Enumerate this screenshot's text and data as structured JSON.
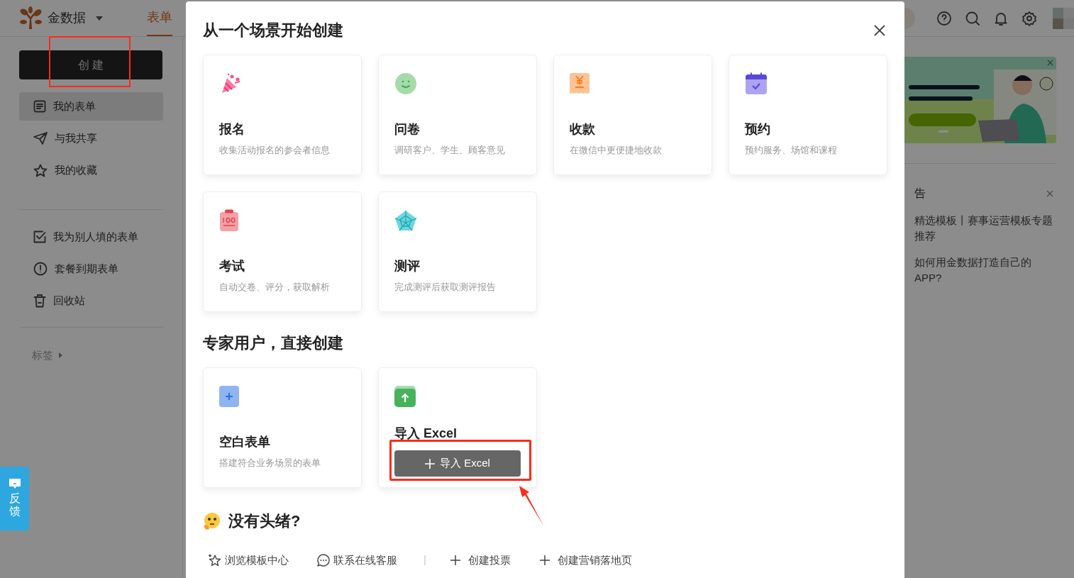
{
  "header": {
    "brand": "金数据",
    "tabs": [
      {
        "label": "表单",
        "selected": true
      }
    ]
  },
  "sidebar": {
    "create_button": "创 建",
    "nav_groups": [
      [
        {
          "label": "我的表单",
          "selected": true
        },
        {
          "label": "与我共享",
          "selected": false
        },
        {
          "label": "我的收藏",
          "selected": false
        }
      ],
      [
        {
          "label": "我为别人填的表单",
          "selected": false
        },
        {
          "label": "套餐到期表单",
          "selected": false
        },
        {
          "label": "回收站",
          "selected": false
        }
      ]
    ],
    "tags_label": "标签"
  },
  "announcement": {
    "title": "告",
    "items": [
      "精选模板丨赛事运营模板专题推荐",
      "如何用金数据打造自己的APP?"
    ]
  },
  "feedback": "反馈",
  "dialog": {
    "title": "从一个场景开始创建",
    "scenes": [
      {
        "title": "报名",
        "description": "收集活动报名的参会者信息"
      },
      {
        "title": "问卷",
        "description": "调研客户、学生、顾客意见"
      },
      {
        "title": "收款",
        "description": "在微信中更便捷地收款"
      },
      {
        "title": "预约",
        "description": "预约服务、场馆和课程"
      },
      {
        "title": "考试",
        "description": "自动交卷、评分，获取解析"
      },
      {
        "title": "测评",
        "description": "完成测评后获取测评报告"
      }
    ],
    "expert_title": "专家用户，直接创建",
    "expert_cards": [
      {
        "kind": "blank",
        "title": "空白表单",
        "description": "搭建符合业务场景的表单"
      },
      {
        "kind": "import",
        "title": "导入 Excel",
        "button": "导入 Excel"
      }
    ],
    "help_title": "没有头绪?",
    "help_links": [
      {
        "kind": "template",
        "label": "浏览模板中心"
      },
      {
        "kind": "chat",
        "label": "联系在线客服"
      },
      {
        "kind": "plus",
        "label": "创建投票"
      },
      {
        "kind": "plus",
        "label": "创建营销落地页"
      }
    ]
  }
}
